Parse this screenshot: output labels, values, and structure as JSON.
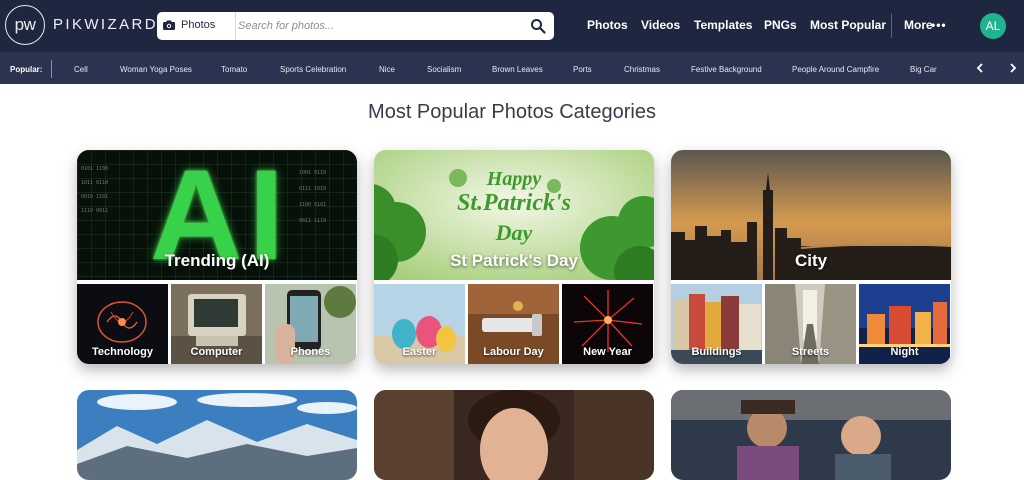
{
  "header": {
    "logo_text": "pw",
    "brand": "PIKWIZARD",
    "search": {
      "type_label": "Photos",
      "placeholder": "Search for photos..."
    },
    "nav": [
      "Photos",
      "Videos",
      "Templates",
      "PNGs",
      "Most Popular"
    ],
    "more_label": "More",
    "more_dots": "•••",
    "avatar_initials": "AL",
    "avatar_color": "#1fb38f"
  },
  "popular": {
    "label": "Popular:",
    "items": [
      "Cell",
      "Woman Yoga Poses",
      "Tomato",
      "Sports Celebration",
      "Nice",
      "Socialism",
      "Brown Leaves",
      "Ports",
      "Christmas",
      "Festive Background",
      "People Around Campfire",
      "Big Car"
    ]
  },
  "page_title": "Most Popular Photos Categories",
  "categories": [
    {
      "title": "Trending (AI)",
      "subs": [
        "Technology",
        "Computer",
        "Phones"
      ]
    },
    {
      "title": "St Patrick's Day",
      "subs": [
        "Easter",
        "Labour Day",
        "New Year"
      ]
    },
    {
      "title": "City",
      "subs": [
        "Buildings",
        "Streets",
        "Night"
      ]
    }
  ],
  "main_image_text": {
    "ai_letters": "AI",
    "st_patricks_line1": "Happy",
    "st_patricks_line2": "St.Patrick's",
    "st_patricks_line3": "Day"
  },
  "colors": {
    "header_bg": "#1f2740",
    "popular_bg": "#2b3350",
    "accent": "#1fb38f"
  }
}
